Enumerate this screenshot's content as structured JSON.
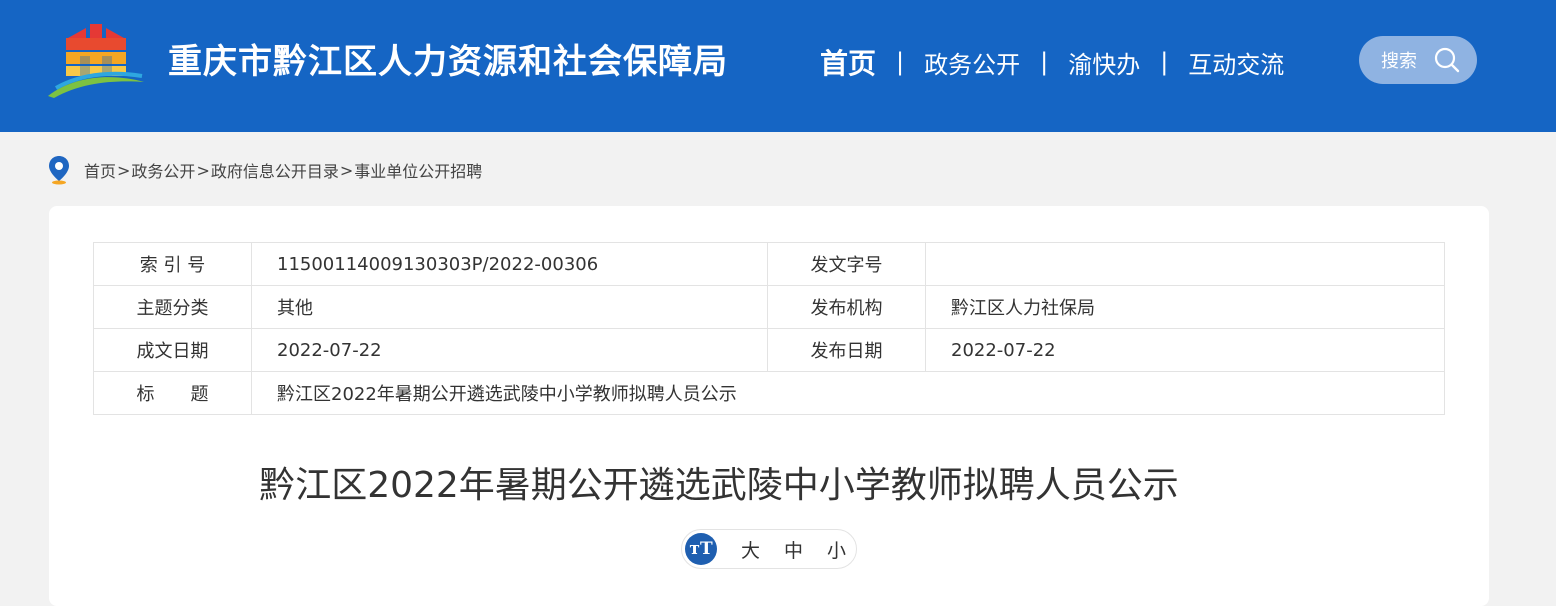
{
  "header": {
    "site_title": "重庆市黔江区人力资源和社会保障局",
    "logo_icon": "city-gate-logo-icon",
    "nav": [
      {
        "label": "首页",
        "active": true
      },
      {
        "label": "政务公开"
      },
      {
        "label": "渝快办"
      },
      {
        "label": "互动交流"
      }
    ],
    "nav_separator": "|",
    "search_label": "搜索",
    "search_icon": "search-icon",
    "colors": {
      "header_bg": "#1565c4",
      "search_bg": "#8fb3e2"
    }
  },
  "breadcrumb": {
    "icon": "location-pin-icon",
    "items": [
      "首页",
      "政务公开",
      "政府信息公开目录",
      "事业单位公开招聘"
    ],
    "separator": ">"
  },
  "meta": {
    "rows": [
      {
        "label1": "索 引 号",
        "value1": "11500114009130303P/2022-00306",
        "label2": "发文字号",
        "value2": ""
      },
      {
        "label1": "主题分类",
        "value1": "其他",
        "label2": "发布机构",
        "value2": "黔江区人力社保局"
      },
      {
        "label1": "成文日期",
        "value1": "2022-07-22",
        "label2": "发布日期",
        "value2": "2022-07-22"
      }
    ],
    "title_label": "标　　题",
    "title_value": "黔江区2022年暑期公开遴选武陵中小学教师拟聘人员公示"
  },
  "article": {
    "title": "黔江区2022年暑期公开遴选武陵中小学教师拟聘人员公示"
  },
  "font_size": {
    "icon_glyph": "тT",
    "icon": "text-size-icon",
    "options": [
      "大",
      "中",
      "小"
    ]
  }
}
